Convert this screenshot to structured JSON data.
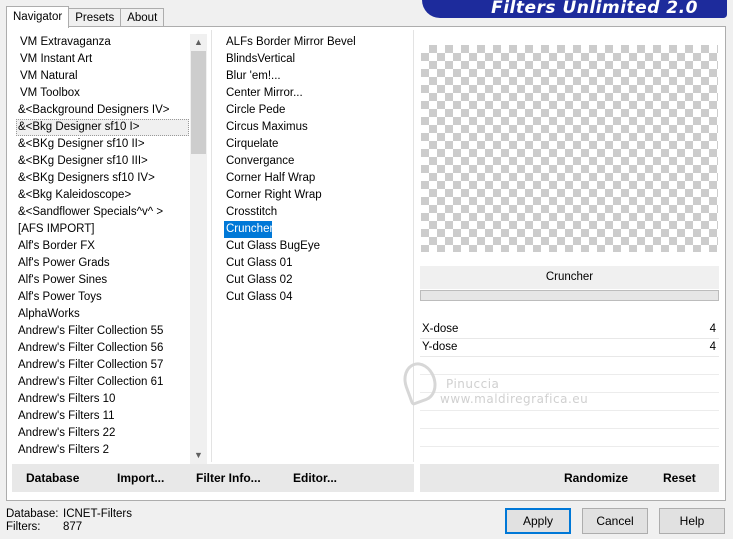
{
  "banner_title": "Filters Unlimited 2.0",
  "tabs": [
    {
      "label": "Navigator"
    },
    {
      "label": "Presets"
    },
    {
      "label": "About"
    }
  ],
  "categories": [
    "VM Extravaganza",
    "VM Instant Art",
    "VM Natural",
    "VM Toolbox",
    "&<Background Designers IV>",
    "&<Bkg Designer sf10 I>",
    "&<BKg Designer sf10 II>",
    "&<BKg Designer sf10 III>",
    "&<BKg Designers sf10 IV>",
    "&<Bkg Kaleidoscope>",
    "&<Sandflower Specials^v^ >",
    "[AFS IMPORT]",
    "Alf's Border FX",
    "Alf's Power Grads",
    "Alf's Power Sines",
    "Alf's Power Toys",
    "AlphaWorks",
    "Andrew's Filter Collection 55",
    "Andrew's Filter Collection 56",
    "Andrew's Filter Collection 57",
    "Andrew's Filter Collection 61",
    "Andrew's Filters 10",
    "Andrew's Filters 11",
    "Andrew's Filters 22",
    "Andrew's Filters 2"
  ],
  "filters": [
    "ALFs Border Mirror Bevel",
    "BlindsVertical",
    "Blur 'em!...",
    "Center Mirror...",
    "Circle Pede",
    "Circus Maximus",
    "Cirquelate",
    "Convergance",
    "Corner Half Wrap",
    "Corner Right Wrap",
    "Crosstitch",
    "Cruncher",
    "Cut Glass  BugEye",
    "Cut Glass 01",
    "Cut Glass 02",
    "Cut Glass 04"
  ],
  "selected_filter": "Cruncher",
  "params": [
    {
      "label": "X-dose",
      "value": "4"
    },
    {
      "label": "Y-dose",
      "value": "4"
    }
  ],
  "toolbar": {
    "database": "Database",
    "import": "Import...",
    "filter_info": "Filter Info...",
    "editor": "Editor...",
    "randomize": "Randomize",
    "reset": "Reset"
  },
  "footer": {
    "database_label": "Database:",
    "database_value": "ICNET-Filters",
    "filters_label": "Filters:",
    "filters_value": "877"
  },
  "buttons": {
    "apply": "Apply",
    "cancel": "Cancel",
    "help": "Help"
  },
  "watermark": {
    "line1": "Pinuccia",
    "line2": "www.maldiregrafica.eu"
  },
  "colors": {
    "banner": "#1d2b9c",
    "selection": "#0078d7",
    "default_button_border": "#0078d7"
  }
}
